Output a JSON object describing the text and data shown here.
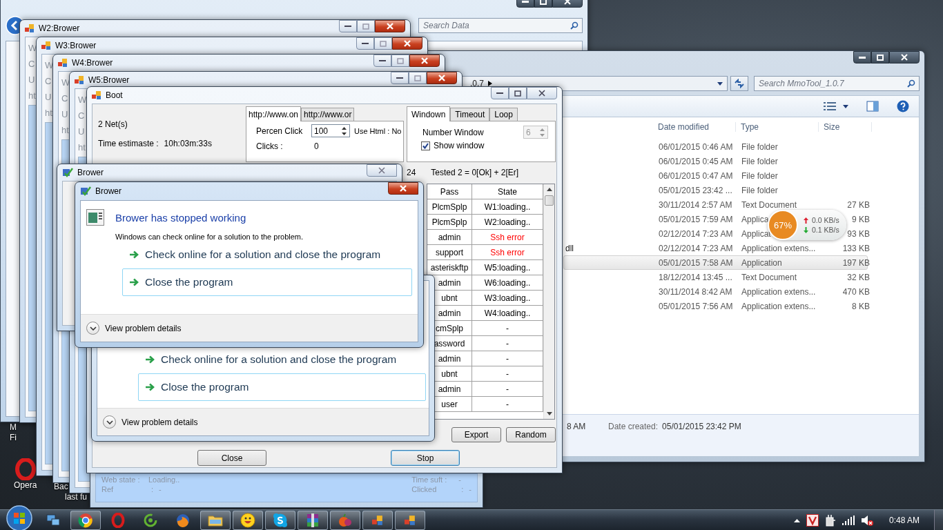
{
  "desktop_icons": [
    {
      "kind": "cut",
      "lines": [
        "M",
        "Fi"
      ]
    },
    {
      "kind": "opera",
      "lines": [
        "Opera"
      ]
    },
    {
      "kind": "cut",
      "lines": [
        "Bac",
        "last fu"
      ]
    }
  ],
  "explorer_back": {
    "search_placeholder": "Search Data"
  },
  "explorer": {
    "address": ".0.7",
    "search_placeholder": "Search MmoTool_1.0.7",
    "columns": [
      "Date modified",
      "Type",
      "Size"
    ],
    "rows": [
      {
        "date": "06/01/2015 0:46 AM",
        "type": "File folder",
        "selected": false
      },
      {
        "date": "06/01/2015 0:45 AM",
        "type": "File folder",
        "selected": false
      },
      {
        "date": "06/01/2015 0:47 AM",
        "type": "File folder",
        "selected": false
      },
      {
        "date": "05/01/2015 23:42 ...",
        "type": "File folder",
        "selected": false
      },
      {
        "date": "30/11/2014 2:57 AM",
        "type": "Text Document",
        "size": "27 KB",
        "selected": false
      },
      {
        "date": "05/01/2015 7:59 AM",
        "type": "Applica",
        "size": "9 KB",
        "selected": false
      },
      {
        "date": "02/12/2014 7:23 AM",
        "type": "Applicat",
        "size": "93 KB",
        "selected": false
      },
      {
        "name": "dll",
        "date": "02/12/2014 7:23 AM",
        "type": "Application extens...",
        "size": "133 KB",
        "selected": false
      },
      {
        "date": "05/01/2015 7:58 AM",
        "type": "Application",
        "size": "197 KB",
        "selected": true
      },
      {
        "date": "18/12/2014 13:45 ...",
        "type": "Text Document",
        "size": "32 KB",
        "selected": false
      },
      {
        "date": "30/11/2014 8:42 AM",
        "type": "Application extens...",
        "size": "470 KB",
        "selected": false
      },
      {
        "date": "05/01/2015 7:56 AM",
        "type": "Application extens...",
        "size": "8 KB",
        "selected": false
      }
    ],
    "details": {
      "cut_text": "8 AM",
      "label": "Date created:",
      "value": "05/01/2015 23:42 PM"
    }
  },
  "brower_windows": [
    {
      "title": "W2:Brower",
      "fragments": [
        "W",
        "C",
        "U",
        "ht"
      ]
    },
    {
      "title": "W3:Brower",
      "fragments": [
        "W",
        "C",
        "U",
        "ht"
      ]
    },
    {
      "title": "W4:Brower",
      "fragments": [
        "W",
        "C",
        "U",
        "ht"
      ]
    },
    {
      "title": "W5:Brower",
      "fragments": [
        "W",
        "C",
        "U",
        "ht"
      ]
    }
  ],
  "status_window": {
    "left": [
      {
        "label": "Web state :",
        "value": "Loading.."
      },
      {
        "label": "Ref",
        "sep": ":",
        "value": "-"
      }
    ],
    "right": [
      {
        "label": "Time suft :",
        "value": "-"
      },
      {
        "label": "Clicked",
        "sep": ":",
        "value": "-"
      }
    ]
  },
  "boot": {
    "title": "Boot",
    "nets": "2 Net(s)",
    "time_label": "Time estimaste :",
    "time_value": "10h:03m:33s",
    "url_tabs": [
      {
        "label": "http://www.on",
        "selected": true
      },
      {
        "label": "http://www.or",
        "selected": false
      }
    ],
    "percent_label": "Percen Click",
    "percent_value": "100",
    "use_html": "Use Html : No",
    "clicks_label": "Clicks :",
    "clicks_value": "0",
    "tabs": [
      {
        "label": "Windown",
        "selected": true
      },
      {
        "label": "Timeout",
        "selected": false
      },
      {
        "label": "Loop",
        "selected": false
      }
    ],
    "number_window": {
      "label": "Number Window",
      "value": "6",
      "disabled": true
    },
    "show_window": {
      "label": "Show window",
      "checked": true
    },
    "count_cut": "24",
    "tested": "Tested 2 = 0[Ok] + 2[Er]",
    "table": {
      "columns": [
        "Pass",
        "State"
      ],
      "rows": [
        {
          "pass": "PlcmSplp",
          "state": "W1:loading..",
          "error": false
        },
        {
          "pass": "PlcmSplp",
          "state": "W2:loading..",
          "error": false
        },
        {
          "pass": "admin",
          "state": "Ssh error",
          "error": true
        },
        {
          "pass": "support",
          "state": "Ssh error",
          "error": true
        },
        {
          "pass": "asteriskftp",
          "state": "W5:loading..",
          "error": false
        },
        {
          "pass": "admin",
          "state": "W6:loading..",
          "error": false
        },
        {
          "pass": "ubnt",
          "state": "W3:loading..",
          "error": false
        },
        {
          "pass": "admin",
          "state": "W4:loading..",
          "error": false
        },
        {
          "pass": "cmSplp",
          "state": "-",
          "error": false
        },
        {
          "pass": "assword",
          "state": "-",
          "error": false
        },
        {
          "pass": "admin",
          "state": "-",
          "error": false
        },
        {
          "pass": "ubnt",
          "state": "-",
          "error": false
        },
        {
          "pass": "admin",
          "state": "-",
          "error": false
        },
        {
          "pass": "user",
          "state": "-",
          "error": false
        }
      ]
    },
    "buttons": [
      "Export",
      "Random"
    ],
    "bottom_buttons": [
      {
        "label": "Close",
        "focused": false
      },
      {
        "label": "Stop",
        "focused": true
      }
    ]
  },
  "dialog_back": {
    "title": "Brower"
  },
  "dialog_middle": {
    "options": [
      {
        "label": "Check online for a solution and close the program",
        "focused": false
      },
      {
        "label": "Close the program",
        "focused": true
      }
    ],
    "details": "View problem details"
  },
  "dialog": {
    "title": "Brower",
    "heading": "Brower has stopped working",
    "text": "Windows can check online for a solution to the problem.",
    "options": [
      {
        "label": "Check online for a solution and close the program",
        "focused": false
      },
      {
        "label": "Close the program",
        "focused": true
      }
    ],
    "details": "View problem details"
  },
  "net_monitor": {
    "percent": "67%",
    "upload": "0.0 KB/s",
    "download": "0.1 KB/s"
  },
  "taskbar": {
    "items": [
      {
        "kind": "network",
        "open": false
      },
      {
        "kind": "browser",
        "open": true
      },
      {
        "kind": "opera",
        "open": false
      },
      {
        "kind": "swirl",
        "open": false
      },
      {
        "kind": "firefox",
        "open": false
      },
      {
        "kind": "folder",
        "open": true
      },
      {
        "kind": "smiley",
        "open": true
      },
      {
        "kind": "chat",
        "open": true
      },
      {
        "kind": "books",
        "open": true
      },
      {
        "kind": "fruit",
        "open": true
      },
      {
        "kind": "app",
        "open": true
      },
      {
        "kind": "app",
        "open": true
      }
    ],
    "clock": "0:48 AM"
  }
}
